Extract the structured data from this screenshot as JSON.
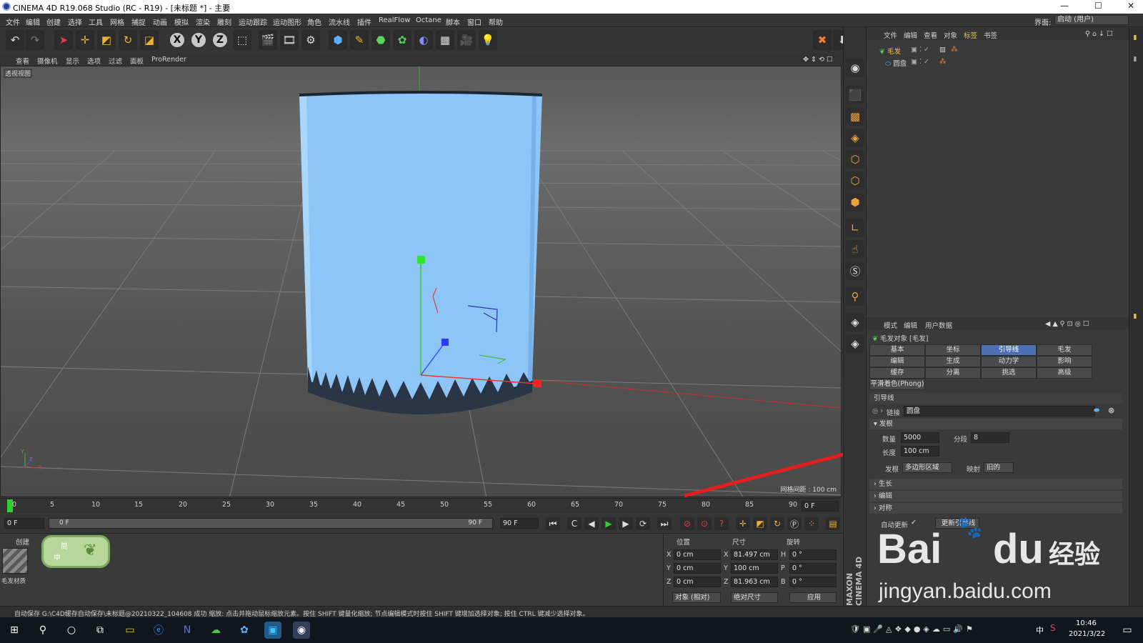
{
  "window": {
    "title": "CINEMA 4D R19.068 Studio (RC - R19) - [未标题 *] - 主要",
    "minimize": "—",
    "maximize": "☐",
    "close": "✕"
  },
  "menubar": {
    "items": [
      "文件",
      "编辑",
      "创建",
      "选择",
      "工具",
      "网格",
      "捕捉",
      "动画",
      "模拟",
      "渲染",
      "雕刻",
      "运动跟踪",
      "运动图形",
      "角色",
      "流水线",
      "插件",
      "RealFlow",
      "Octane",
      "脚本",
      "窗口",
      "帮助"
    ],
    "interface_label": "界面:",
    "interface_value": "启动 (用户)"
  },
  "viewport": {
    "menu": [
      "查看",
      "摄像机",
      "显示",
      "选项",
      "过滤",
      "面板",
      "ProRender"
    ],
    "label": "透视视图",
    "grid_spacing": "网格间距 : 100 cm",
    "axis_y": "Y",
    "axis_x": "X",
    "axis_z": "Z"
  },
  "object_manager": {
    "menu": [
      "文件",
      "编辑",
      "查看",
      "对象",
      "标签",
      "书签"
    ],
    "objects": [
      {
        "name": "毛发"
      },
      {
        "name": "圆盘"
      }
    ]
  },
  "attributes": {
    "menu": [
      "模式",
      "编辑",
      "用户数据"
    ],
    "object_title": "毛发对象 [毛发]",
    "tabs": [
      [
        "基本",
        "坐标",
        "引导线",
        "毛发"
      ],
      [
        "编辑",
        "生成",
        "动力学",
        "影响"
      ],
      [
        "缓存",
        "分离",
        "挑选",
        "高级"
      ]
    ],
    "active_tab": "引导线",
    "phong_tab": "平滑着色(Phong)",
    "section_title": "引导线",
    "link_label": "链接",
    "link_value": "圆盘",
    "root_section": "发根",
    "count_label": "数量",
    "count_value": "5000",
    "segments_label": "分段",
    "segments_value": "8",
    "length_label": "长度",
    "length_value": "100 cm",
    "root_label": "发根",
    "root_value": "多边形区域",
    "mapping_label": "映射",
    "mapping_value": "旧的",
    "collapsed_sections": [
      "生长",
      "编辑",
      "对称"
    ],
    "auto_update_label": "自动更新",
    "update_button": "更新引导线"
  },
  "timeline": {
    "ticks": [
      "0",
      "5",
      "10",
      "15",
      "20",
      "25",
      "30",
      "35",
      "40",
      "45",
      "50",
      "55",
      "60",
      "65",
      "70",
      "75",
      "80",
      "85",
      "90"
    ],
    "current_frame": "0 F",
    "start_frame": "0 F",
    "range_start": "0 F",
    "range_end": "90 F",
    "end_frame": "90 F"
  },
  "material_manager": {
    "menu": [
      "创建"
    ],
    "material_name": "毛发材质",
    "ime_text": "简",
    "ime_lang": "中"
  },
  "coordinates": {
    "headers": [
      "位置",
      "尺寸",
      "旋转"
    ],
    "rows": [
      {
        "axis": "X",
        "pos": "0 cm",
        "size_axis": "X",
        "size": "81.497 cm",
        "rot_axis": "H",
        "rot": "0 °"
      },
      {
        "axis": "Y",
        "pos": "0 cm",
        "size_axis": "Y",
        "size": "100 cm",
        "rot_axis": "P",
        "rot": "0 °"
      },
      {
        "axis": "Z",
        "pos": "0 cm",
        "size_axis": "Z",
        "size": "81.963 cm",
        "rot_axis": "B",
        "rot": "0 °"
      }
    ],
    "mode_dropdown": "对象 (相对)",
    "size_dropdown": "绝对尺寸",
    "apply_button": "应用"
  },
  "maxon_logo": "MAXON CINEMA 4D",
  "status": "自动保存 G:\\C4D缓存自动保存\\未标题@20210322_104608 成功  缩放: 点击并拖动鼠标缩放元素。按住 SHIFT 键量化缩放; 节点编辑模式时按住 SHIFT 键增加选择对象; 按住 CTRL 键减少选择对象。",
  "taskbar": {
    "time": "10:46",
    "date": "2021/3/22",
    "ime": "中"
  },
  "watermark": {
    "brand": "Bai",
    "brand2": "du",
    "text": "经验",
    "url": "jingyan.baidu.com"
  }
}
